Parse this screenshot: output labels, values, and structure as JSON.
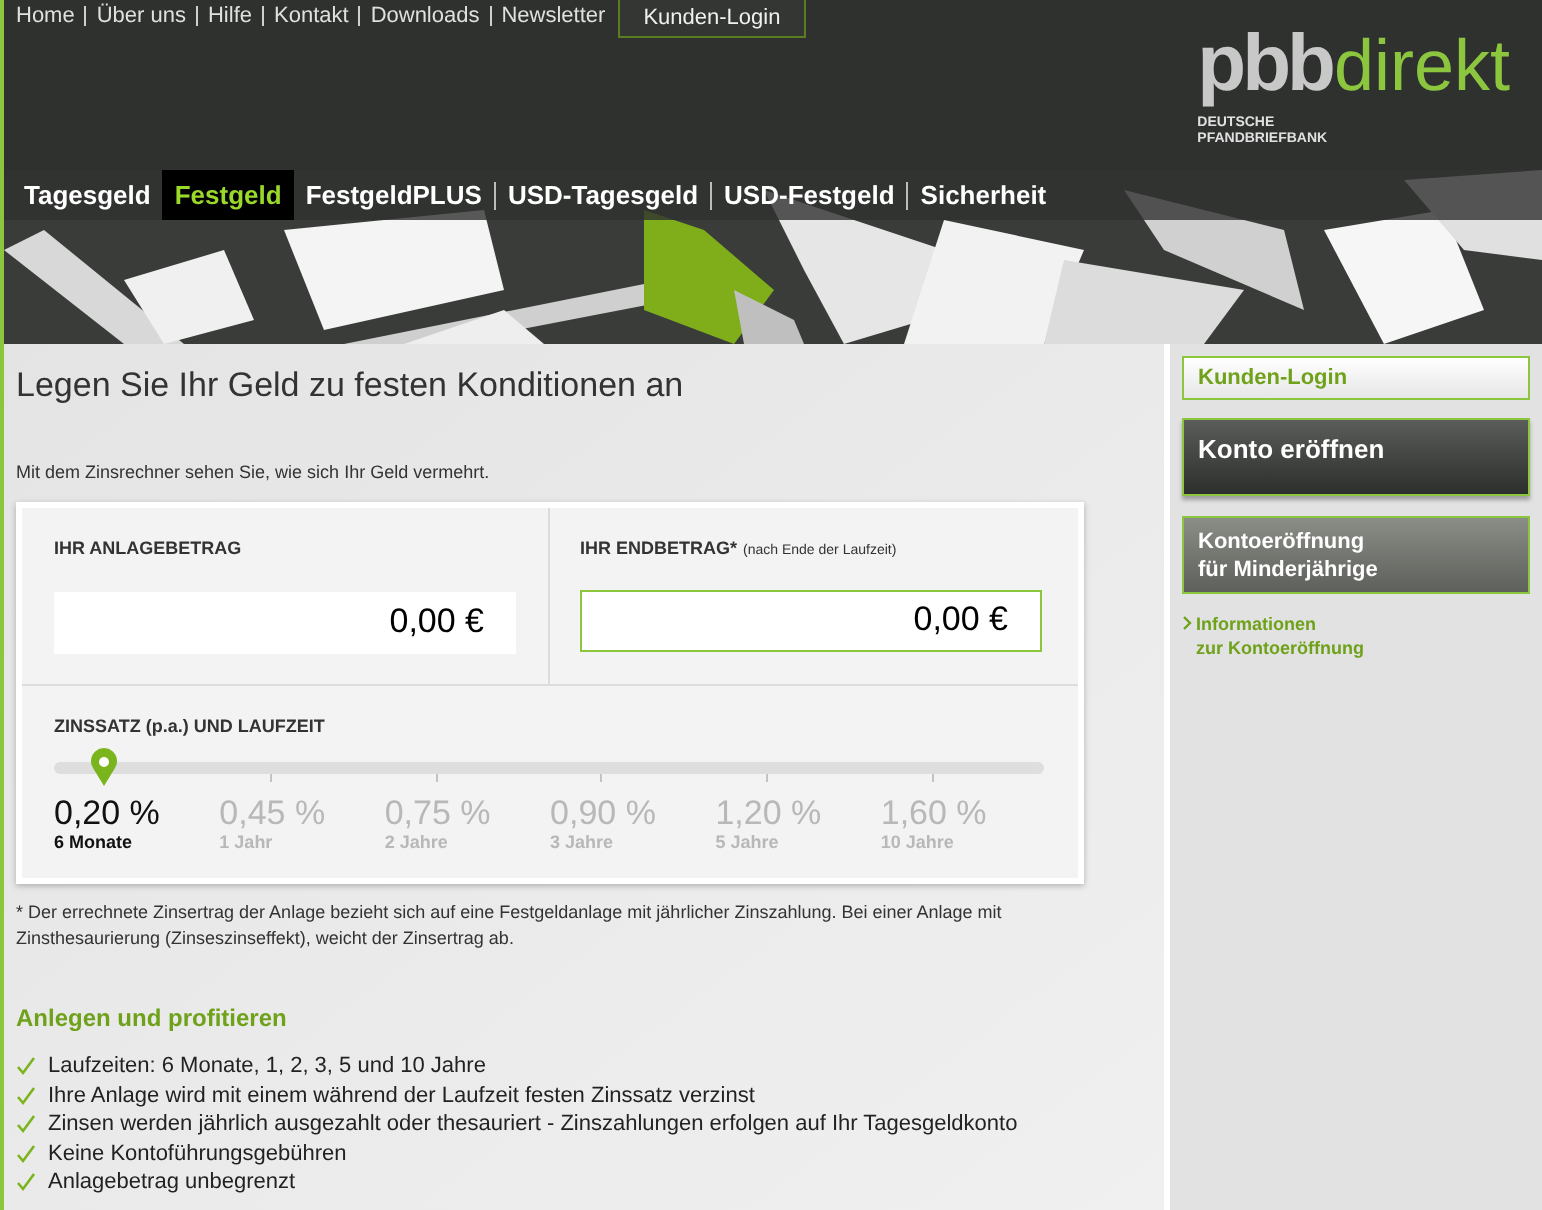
{
  "top_nav": {
    "links": [
      "Home",
      "Über uns",
      "Hilfe",
      "Kontakt",
      "Downloads",
      "Newsletter"
    ],
    "login": "Kunden-Login"
  },
  "logo": {
    "part_1": "pbb",
    "part_2": "direkt",
    "subtitle_1": "DEUTSCHE",
    "subtitle_2": "PFANDBRIEFBANK"
  },
  "tabs": [
    {
      "label": "Tagesgeld",
      "selected": false
    },
    {
      "label": "Festgeld",
      "selected": true
    },
    {
      "label": "FestgeldPLUS",
      "selected": false
    },
    {
      "label": "USD-Tagesgeld",
      "selected": false
    },
    {
      "label": "USD-Festgeld",
      "selected": false
    },
    {
      "label": "Sicherheit",
      "selected": false
    }
  ],
  "heading": "Legen Sie Ihr Geld zu festen Konditionen an",
  "intro": "Mit dem Zinsrechner sehen Sie, wie sich Ihr Geld vermehrt.",
  "calculator": {
    "amount": {
      "label": "IHR ANLAGEBETRAG",
      "value": "0,00 €"
    },
    "result": {
      "label": "IHR ENDBETRAG*",
      "note": "(nach Ende der Laufzeit)",
      "value": "0,00 €"
    },
    "rate_label": "ZINSSATZ (p.a.) UND LAUFZEIT",
    "slider": {
      "level": 0.05
    },
    "options": [
      {
        "rate": "0,20 %",
        "term": "6 Monate",
        "selected": true
      },
      {
        "rate": "0,45 %",
        "term": "1 Jahr",
        "selected": false
      },
      {
        "rate": "0,75 %",
        "term": "2 Jahre",
        "selected": false
      },
      {
        "rate": "0,90 %",
        "term": "3 Jahre",
        "selected": false
      },
      {
        "rate": "1,20 %",
        "term": "5 Jahre",
        "selected": false
      },
      {
        "rate": "1,60 %",
        "term": "10 Jahre",
        "selected": false
      }
    ]
  },
  "footnote": "* Der errechnete Zinsertrag der Anlage bezieht sich auf eine Festgeldanlage mit jährlicher Zinszahlung. Bei einer Anlage mit Zinsthesaurierung (Zinseszinseffekt), weicht der Zinsertrag ab.",
  "benefits": {
    "title": "Anlegen und profitieren",
    "items": [
      "Laufzeiten: 6 Monate, 1, 2, 3, 5 und 10 Jahre",
      "Ihre Anlage wird mit einem während der Laufzeit festen Zinssatz verzinst",
      "Zinsen werden jährlich ausgezahlt oder thesauriert - Zinszahlungen erfolgen auf Ihr Tagesgeldkonto",
      "Keine Kontoführungsgebühren",
      "Anlagebetrag unbegrenzt"
    ]
  },
  "sidebar": {
    "login": "Kunden-Login",
    "open_account": "Konto eröffnen",
    "minors_1": "Kontoeröffnung",
    "minors_2": "für Minderjährige",
    "info_1": "Informationen",
    "info_2": "zur Kontoeröffnung"
  }
}
